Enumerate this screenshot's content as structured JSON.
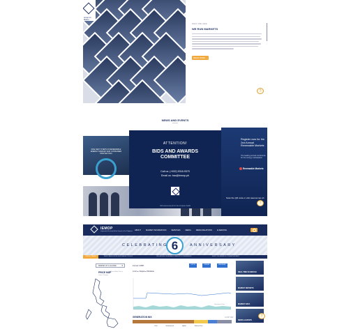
{
  "section1": {
    "logo_sub": "Iemop for Market",
    "eyebrow": "WHO WE ARE",
    "headline": "WE RUN MARKETS",
    "read_more": "READ MORE",
    "chat": "?"
  },
  "news": {
    "heading": "NEWS AND EVENTS",
    "banner_left_title": "DOE NEXT STEPS IN RENEWABLE ENERGY MARKET AND CONSUMER PROTECTION",
    "banner_center": {
      "attention": "ATTENTION!",
      "title_line1": "BIDS AND AWARDS",
      "title_line2": "COMMITTEE",
      "call_line": "Call us: (+632) 5318-9370",
      "email_line": "Email us: bac@iemop.ph",
      "footer": "Visit www.iemop.ph for the complete details"
    },
    "banner_right": {
      "title": "Register now for the 2nd Annual Renewable Markets",
      "sub": "The leading annual conference for the energy marketplace",
      "logo": "Renewable Markets",
      "bottom_text": "Scan the QR code or visit www.iemop.ph"
    },
    "chat": "?"
  },
  "site": {
    "brand": "IEMOP",
    "brand_sub": "Independent Electricity Market Operator of the Philippines",
    "menu": [
      "ABOUT",
      "MARKET INFORMATION",
      "SERVICES",
      "MEDIA",
      "MEDIA RELATIONS",
      "E-SERVICE"
    ],
    "celebrating": "CELEBRATING",
    "anniversary": "ANNIVERSARY",
    "anniv_number": "6",
    "ticker_tag": "LATEST NEWS",
    "ticker_items": [
      "IEMOP ANNOUNCES NEW MARKET RULES",
      "2ND ANNUAL RENEWABLE MARKETS CONFERENCE",
      "IEMOP CELEBRATES 6TH ANNIVERSARY"
    ],
    "market_select": "MARKET AT A GLANCE",
    "price_map_label": "PRICE MAP",
    "price_map_sub": "Luzon Visayas",
    "price_check": "● Show Node Prices",
    "chart_labels": {
      "interval": "Interval: 1300H",
      "region": "Luzon  ● Visayas  ● Mindanao",
      "chart_note": "Generated Chart"
    },
    "legend": [
      {
        "label": "LUZON",
        "color": "#2f6fd0"
      },
      {
        "label": "VISAYAS",
        "color": "#2f6fd0"
      },
      {
        "label": "MINDANAO",
        "color": "#2f6fd0"
      }
    ],
    "gen_title": "GENERATION MIX",
    "gen_value": "13,467 MW",
    "gen_mix": [
      {
        "name": "Coal",
        "share": 0.62,
        "color": "#b5773a"
      },
      {
        "name": "Geothermal",
        "share": 0.14,
        "color": "#f2c94c"
      },
      {
        "name": "Hydro",
        "share": 0.09,
        "color": "#4a7fd6"
      },
      {
        "name": "Natural Gas",
        "share": 0.15,
        "color": "#8a8fa5"
      }
    ],
    "gen_legend": [
      "Coal",
      "Geothermal",
      "Hydro",
      "Natural Gas"
    ],
    "side_cards": [
      "REAL-TIME SCHEDULE",
      "MARKET REPORTS",
      "MARKET DATA",
      "NEWS & EVENTS"
    ],
    "chat": "?"
  }
}
